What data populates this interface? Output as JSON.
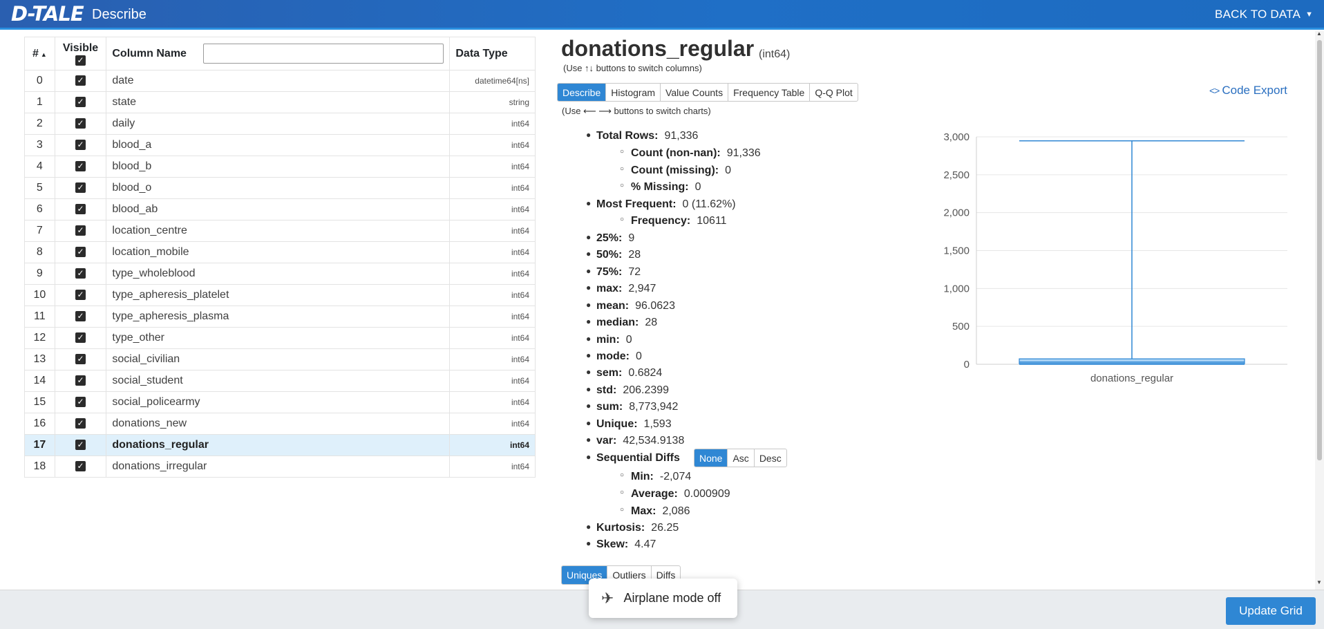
{
  "header": {
    "logo": "D-TALE",
    "title": "Describe",
    "back_label": "BACK TO DATA"
  },
  "columns_table": {
    "headers": {
      "index": "#",
      "visible": "Visible",
      "name": "Column Name",
      "dtype": "Data Type"
    },
    "filter_placeholder": "",
    "rows": [
      {
        "index": "0",
        "name": "date",
        "dtype": "datetime64[ns]"
      },
      {
        "index": "1",
        "name": "state",
        "dtype": "string"
      },
      {
        "index": "2",
        "name": "daily",
        "dtype": "int64"
      },
      {
        "index": "3",
        "name": "blood_a",
        "dtype": "int64"
      },
      {
        "index": "4",
        "name": "blood_b",
        "dtype": "int64"
      },
      {
        "index": "5",
        "name": "blood_o",
        "dtype": "int64"
      },
      {
        "index": "6",
        "name": "blood_ab",
        "dtype": "int64"
      },
      {
        "index": "7",
        "name": "location_centre",
        "dtype": "int64"
      },
      {
        "index": "8",
        "name": "location_mobile",
        "dtype": "int64"
      },
      {
        "index": "9",
        "name": "type_wholeblood",
        "dtype": "int64"
      },
      {
        "index": "10",
        "name": "type_apheresis_platelet",
        "dtype": "int64"
      },
      {
        "index": "11",
        "name": "type_apheresis_plasma",
        "dtype": "int64"
      },
      {
        "index": "12",
        "name": "type_other",
        "dtype": "int64"
      },
      {
        "index": "13",
        "name": "social_civilian",
        "dtype": "int64"
      },
      {
        "index": "14",
        "name": "social_student",
        "dtype": "int64"
      },
      {
        "index": "15",
        "name": "social_policearmy",
        "dtype": "int64"
      },
      {
        "index": "16",
        "name": "donations_new",
        "dtype": "int64"
      },
      {
        "index": "17",
        "name": "donations_regular",
        "dtype": "int64",
        "selected": true
      },
      {
        "index": "18",
        "name": "donations_irregular",
        "dtype": "int64"
      }
    ]
  },
  "detail": {
    "column_name": "donations_regular",
    "dtype": "(int64)",
    "hint_columns": "(Use ↑↓ buttons to switch columns)",
    "hint_charts": "(Use ⟵ ⟶ buttons to switch charts)",
    "tabs": [
      "Describe",
      "Histogram",
      "Value Counts",
      "Frequency Table",
      "Q-Q Plot"
    ],
    "active_tab": "Describe",
    "code_export_label": "Code Export",
    "code_export_icon": "code-brackets-icon",
    "stats": {
      "total_rows": {
        "label": "Total Rows:",
        "value": "91,336"
      },
      "count_nonnan": {
        "label": "Count (non-nan):",
        "value": "91,336"
      },
      "count_missing": {
        "label": "Count (missing):",
        "value": "0"
      },
      "pct_missing": {
        "label": "% Missing:",
        "value": "0"
      },
      "most_frequent": {
        "label": "Most Frequent:",
        "value": "0 (11.62%)"
      },
      "frequency": {
        "label": "Frequency:",
        "value": "10611"
      },
      "p25": {
        "label": "25%:",
        "value": "9"
      },
      "p50": {
        "label": "50%:",
        "value": "28"
      },
      "p75": {
        "label": "75%:",
        "value": "72"
      },
      "max": {
        "label": "max:",
        "value": "2,947"
      },
      "mean": {
        "label": "mean:",
        "value": "96.0623"
      },
      "median": {
        "label": "median:",
        "value": "28"
      },
      "min": {
        "label": "min:",
        "value": "0"
      },
      "mode": {
        "label": "mode:",
        "value": "0"
      },
      "sem": {
        "label": "sem:",
        "value": "0.6824"
      },
      "std": {
        "label": "std:",
        "value": "206.2399"
      },
      "sum": {
        "label": "sum:",
        "value": "8,773,942"
      },
      "unique": {
        "label": "Unique:",
        "value": "1,593"
      },
      "var": {
        "label": "var:",
        "value": "42,534.9138"
      },
      "seq_diffs": {
        "label": "Sequential Diffs"
      },
      "seq_min": {
        "label": "Min:",
        "value": "-2,074"
      },
      "seq_avg": {
        "label": "Average:",
        "value": "0.000909"
      },
      "seq_max": {
        "label": "Max:",
        "value": "2,086"
      },
      "kurtosis": {
        "label": "Kurtosis:",
        "value": "26.25"
      },
      "skew": {
        "label": "Skew:",
        "value": "4.47"
      }
    },
    "seq_sort_options": [
      "None",
      "Asc",
      "Desc"
    ],
    "seq_sort_active": "None",
    "bottom_tabs": [
      "Uniques",
      "Outliers",
      "Diffs"
    ],
    "bottom_tab_active": "Uniques"
  },
  "chart_data": {
    "type": "box",
    "categories": [
      "donations_regular"
    ],
    "series": [
      {
        "min": 0,
        "q1": 9,
        "median": 28,
        "q3": 72,
        "max": 2947
      }
    ],
    "yticks": [
      "0",
      "500",
      "1,000",
      "1,500",
      "2,000",
      "2,500",
      "3,000"
    ],
    "ylim": [
      0,
      3000
    ],
    "grid": true,
    "color": "#2f87d4"
  },
  "footer": {
    "update_label": "Update Grid",
    "toast_text": "Airplane mode off",
    "toast_icon": "airplane-icon"
  }
}
